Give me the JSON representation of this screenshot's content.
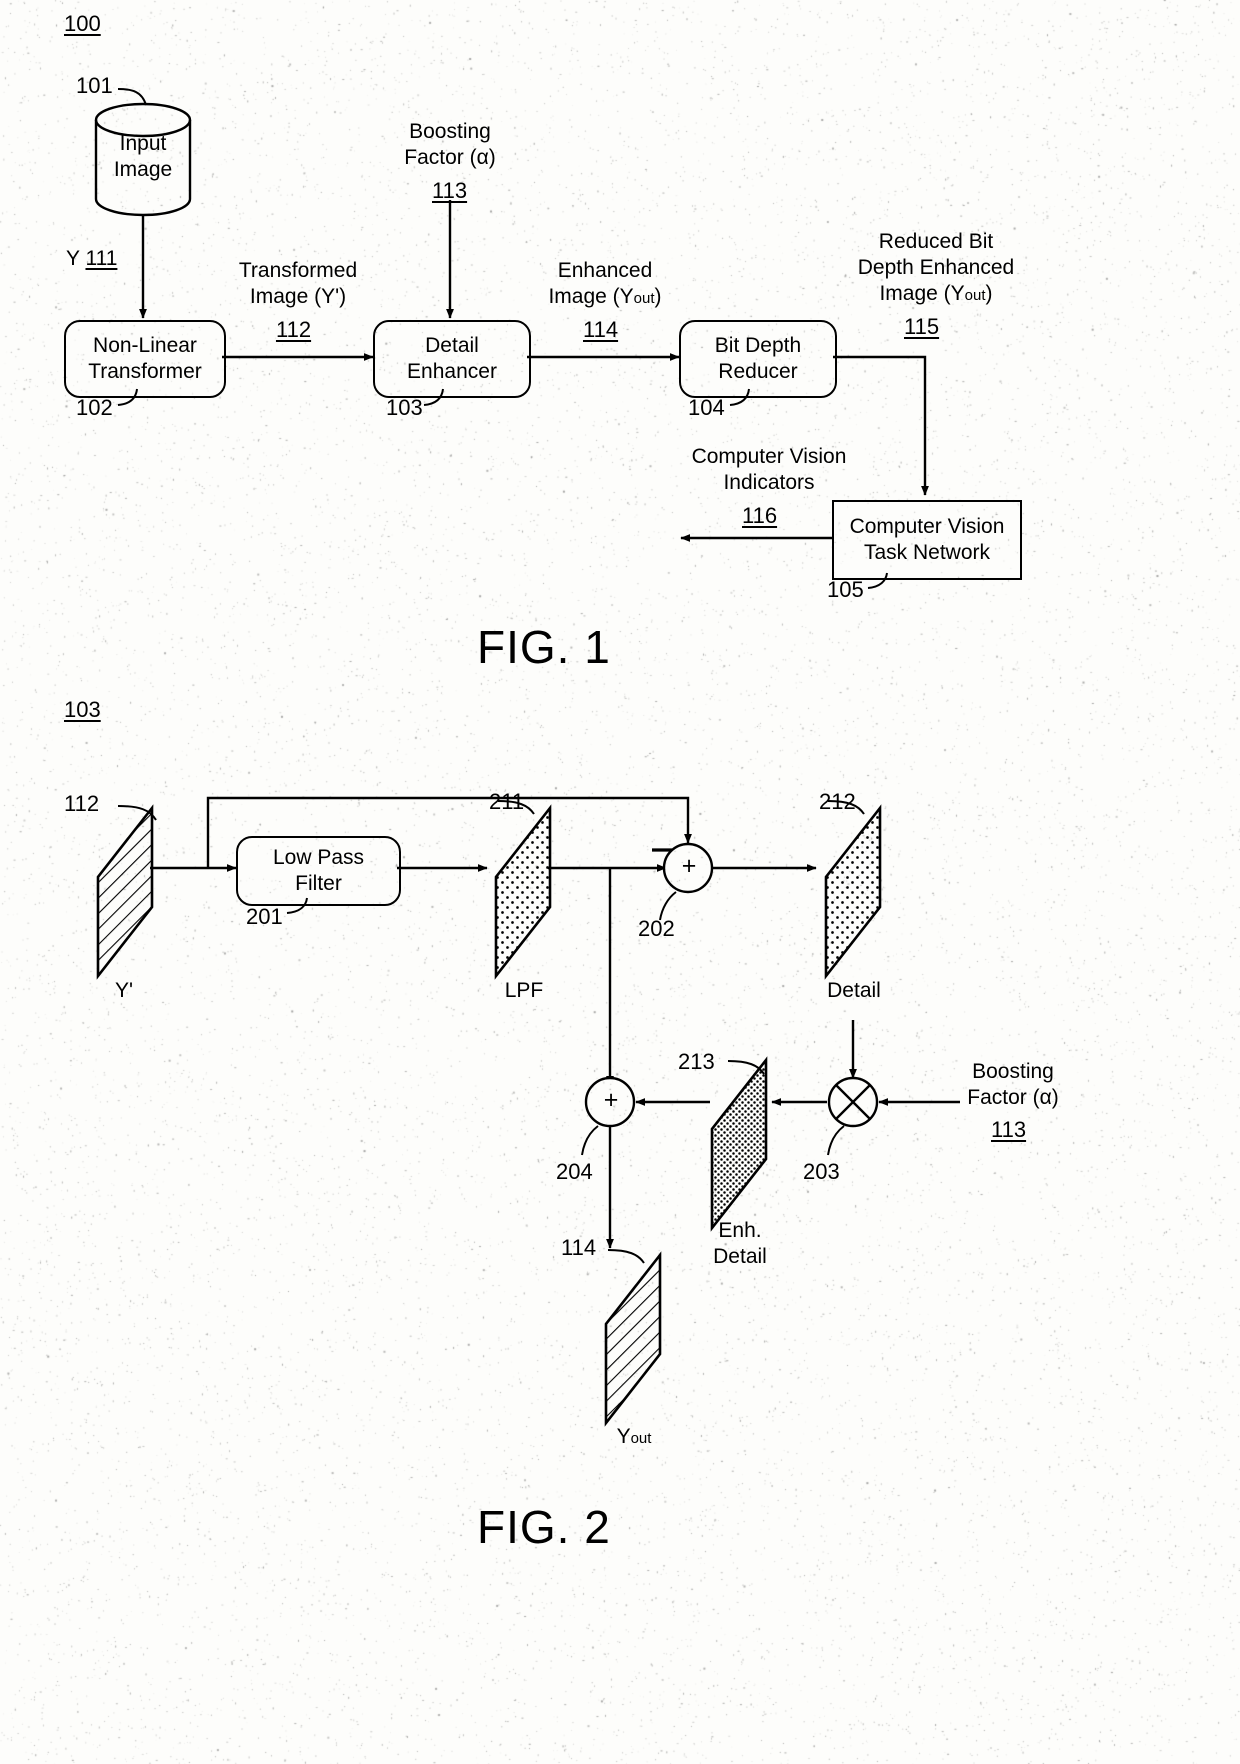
{
  "figure1": {
    "ref": "100",
    "caption": "FIG. 1",
    "nodes": [
      {
        "id": "101",
        "label": "Input\nImage",
        "ref": "101",
        "shape": "cylinder"
      },
      {
        "id": "102",
        "label": "Non-Linear\nTransformer",
        "ref": "102",
        "shape": "rounded-box"
      },
      {
        "id": "103",
        "label": "Detail\nEnhancer",
        "ref": "103",
        "shape": "rounded-box"
      },
      {
        "id": "104",
        "label": "Bit Depth\nReducer",
        "ref": "104",
        "shape": "rounded-box"
      },
      {
        "id": "105",
        "label": "Computer Vision\nTask Network",
        "ref": "105",
        "shape": "box"
      }
    ],
    "signals": [
      {
        "id": "111",
        "label": "Y",
        "ref": "111"
      },
      {
        "id": "112",
        "label": "Transformed\nImage (Y')",
        "ref": "112"
      },
      {
        "id": "113",
        "label": "Boosting\nFactor (α)",
        "ref": "113"
      },
      {
        "id": "114",
        "label": "Enhanced\nImage (Yout)",
        "ref": "114"
      },
      {
        "id": "115",
        "label": "Reduced Bit\nDepth Enhanced\nImage (Yout)",
        "ref": "115"
      },
      {
        "id": "116",
        "label": "Computer Vision\nIndicators",
        "ref": "116"
      }
    ]
  },
  "figure2": {
    "ref": "103",
    "caption": "FIG. 2",
    "nodes": [
      {
        "id": "201",
        "label": "Low Pass\nFilter",
        "ref": "201",
        "shape": "rounded-box"
      },
      {
        "id": "202",
        "label": "+",
        "ref": "202",
        "shape": "sum-circle",
        "minus_input": "−"
      },
      {
        "id": "203",
        "label": "⊗",
        "ref": "203",
        "shape": "mult-circle"
      },
      {
        "id": "204",
        "label": "+",
        "ref": "204",
        "shape": "sum-circle"
      }
    ],
    "planes": [
      {
        "ref": "112",
        "caption": "Y'",
        "fill": "diagonal-hatch"
      },
      {
        "ref": "211",
        "caption": "LPF",
        "fill": "sparse-dots"
      },
      {
        "ref": "212",
        "caption": "Detail",
        "fill": "sparse-dots"
      },
      {
        "ref": "213",
        "caption": "Enh.\nDetail",
        "fill": "dense-dots"
      },
      {
        "ref": "114",
        "caption": "Yout",
        "fill": "diagonal-hatch"
      }
    ],
    "signals": [
      {
        "id": "113",
        "label": "Boosting\nFactor (α)",
        "ref": "113"
      }
    ]
  },
  "text": {
    "fig1_ref": "100",
    "fig1_caption": "FIG. 1",
    "fig2_ref": "103",
    "fig2_caption": "FIG. 2",
    "input_image": "Input\nImage",
    "non_linear_transformer": "Non-Linear\nTransformer",
    "detail_enhancer": "Detail\nEnhancer",
    "bit_depth_reducer": "Bit Depth\nReducer",
    "cv_task_network": "Computer Vision\nTask Network",
    "y_signal": "Y",
    "n111": "111",
    "n112": "112",
    "n113": "113",
    "n114": "114",
    "n115": "115",
    "n116": "116",
    "n101": "101",
    "n102": "102",
    "n103": "103",
    "n104": "104",
    "n105": "105",
    "transformed_image": "Transformed\nImage (Y')",
    "boosting_factor": "Boosting\nFactor (α)",
    "enhanced_image_l1": "Enhanced",
    "enhanced_image_l2": "Image (Y",
    "enhanced_image_sub": "out",
    "enhanced_image_l3": ")",
    "reduced_l1": "Reduced Bit",
    "reduced_l2": "Depth Enhanced",
    "reduced_l3": "Image (Y",
    "reduced_sub": "out",
    "reduced_l4": ")",
    "cv_indicators": "Computer Vision\nIndicators",
    "low_pass_filter": "Low Pass\nFilter",
    "n201": "201",
    "n202": "202",
    "n203": "203",
    "n204": "204",
    "n211": "211",
    "n212": "212",
    "n213": "213",
    "plane_yprime": "Y'",
    "plane_lpf": "LPF",
    "plane_detail": "Detail",
    "plane_enh_detail": "Enh.\nDetail",
    "plane_yout": "Y",
    "plane_yout_sub": "out",
    "minus_sign": "−",
    "plus_sign": "+",
    "boosting_factor2": "Boosting\nFactor (α)",
    "n113b": "113",
    "n112b": "112",
    "n114b": "114"
  },
  "colors": {
    "ink": "#000000",
    "paper": "#fdfdfb"
  }
}
